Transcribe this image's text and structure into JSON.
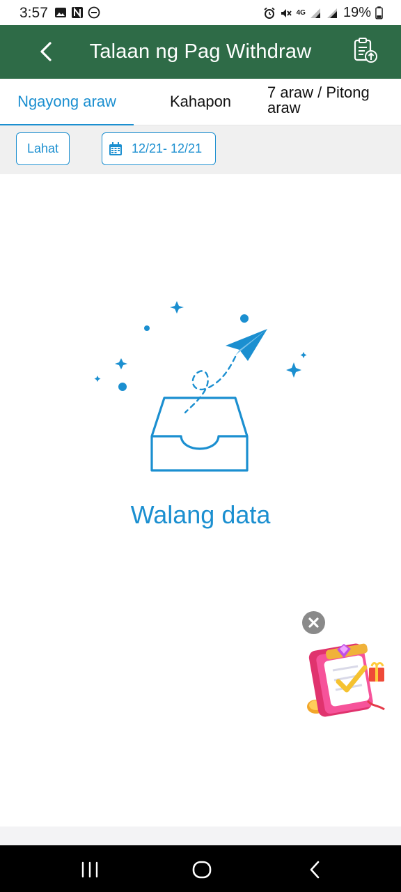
{
  "status_bar": {
    "time": "3:57",
    "network": "4G",
    "battery_percent": "19%",
    "left_icons": [
      "gallery-icon",
      "app-n-icon",
      "dnd-icon"
    ],
    "right_icons": [
      "alarm-icon",
      "mute-icon",
      "signal-icon",
      "signal-icon",
      "battery-icon"
    ]
  },
  "header": {
    "title": "Talaan ng Pag Withdraw",
    "back_icon": "chevron-left-icon",
    "action_icon": "clipboard-upload-icon",
    "background_color": "#2e6b47"
  },
  "tabs": [
    {
      "label": "Ngayong araw",
      "active": true
    },
    {
      "label": "Kahapon",
      "active": false
    },
    {
      "label": "7 araw / Pitong araw",
      "active": false
    }
  ],
  "filters": {
    "all_label": "Lahat",
    "date_range": "12/21- 12/21",
    "date_icon": "calendar-icon"
  },
  "empty_state": {
    "message": "Walang data",
    "icon": "empty-inbox-icon"
  },
  "promo": {
    "close_icon": "close-icon",
    "badge_icon": "gift-checklist-icon"
  },
  "nav_bar": {
    "icons": [
      "recents-icon",
      "home-icon",
      "back-icon"
    ]
  },
  "colors": {
    "accent": "#1b8fd0",
    "header": "#2e6b47",
    "filter_bg": "#f0f0f0"
  }
}
